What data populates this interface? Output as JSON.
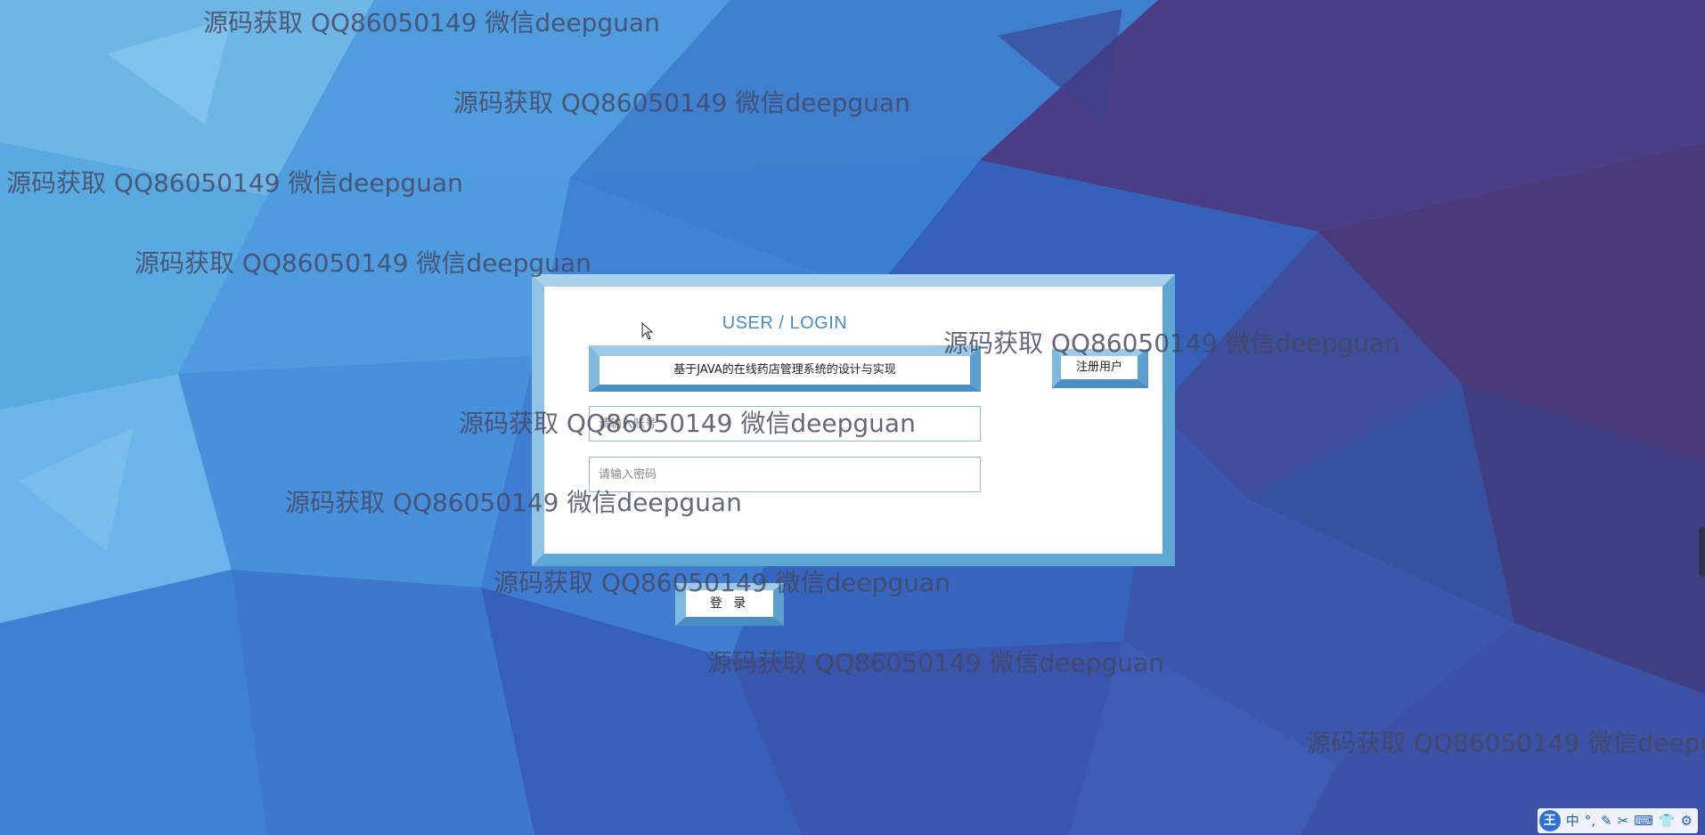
{
  "login_panel": {
    "title": "USER / LOGIN",
    "system_name": "基于JAVA的在线药店管理系统的设计与实现",
    "register_label": "注册用户",
    "username_placeholder": "请输入账号",
    "password_placeholder": "请输入密码",
    "login_label": "登 录"
  },
  "watermark_text": "源码获取 QQ86050149 微信deepguan",
  "ime_toolbar": {
    "logo": "王",
    "mode": "中",
    "items": [
      "°,",
      "✎",
      "✂",
      "⌨",
      "👕",
      "⚙"
    ]
  },
  "colors": {
    "panel_border": "#5ea6d3",
    "title_text": "#4a8cc6",
    "background": "#3a7fcf"
  }
}
